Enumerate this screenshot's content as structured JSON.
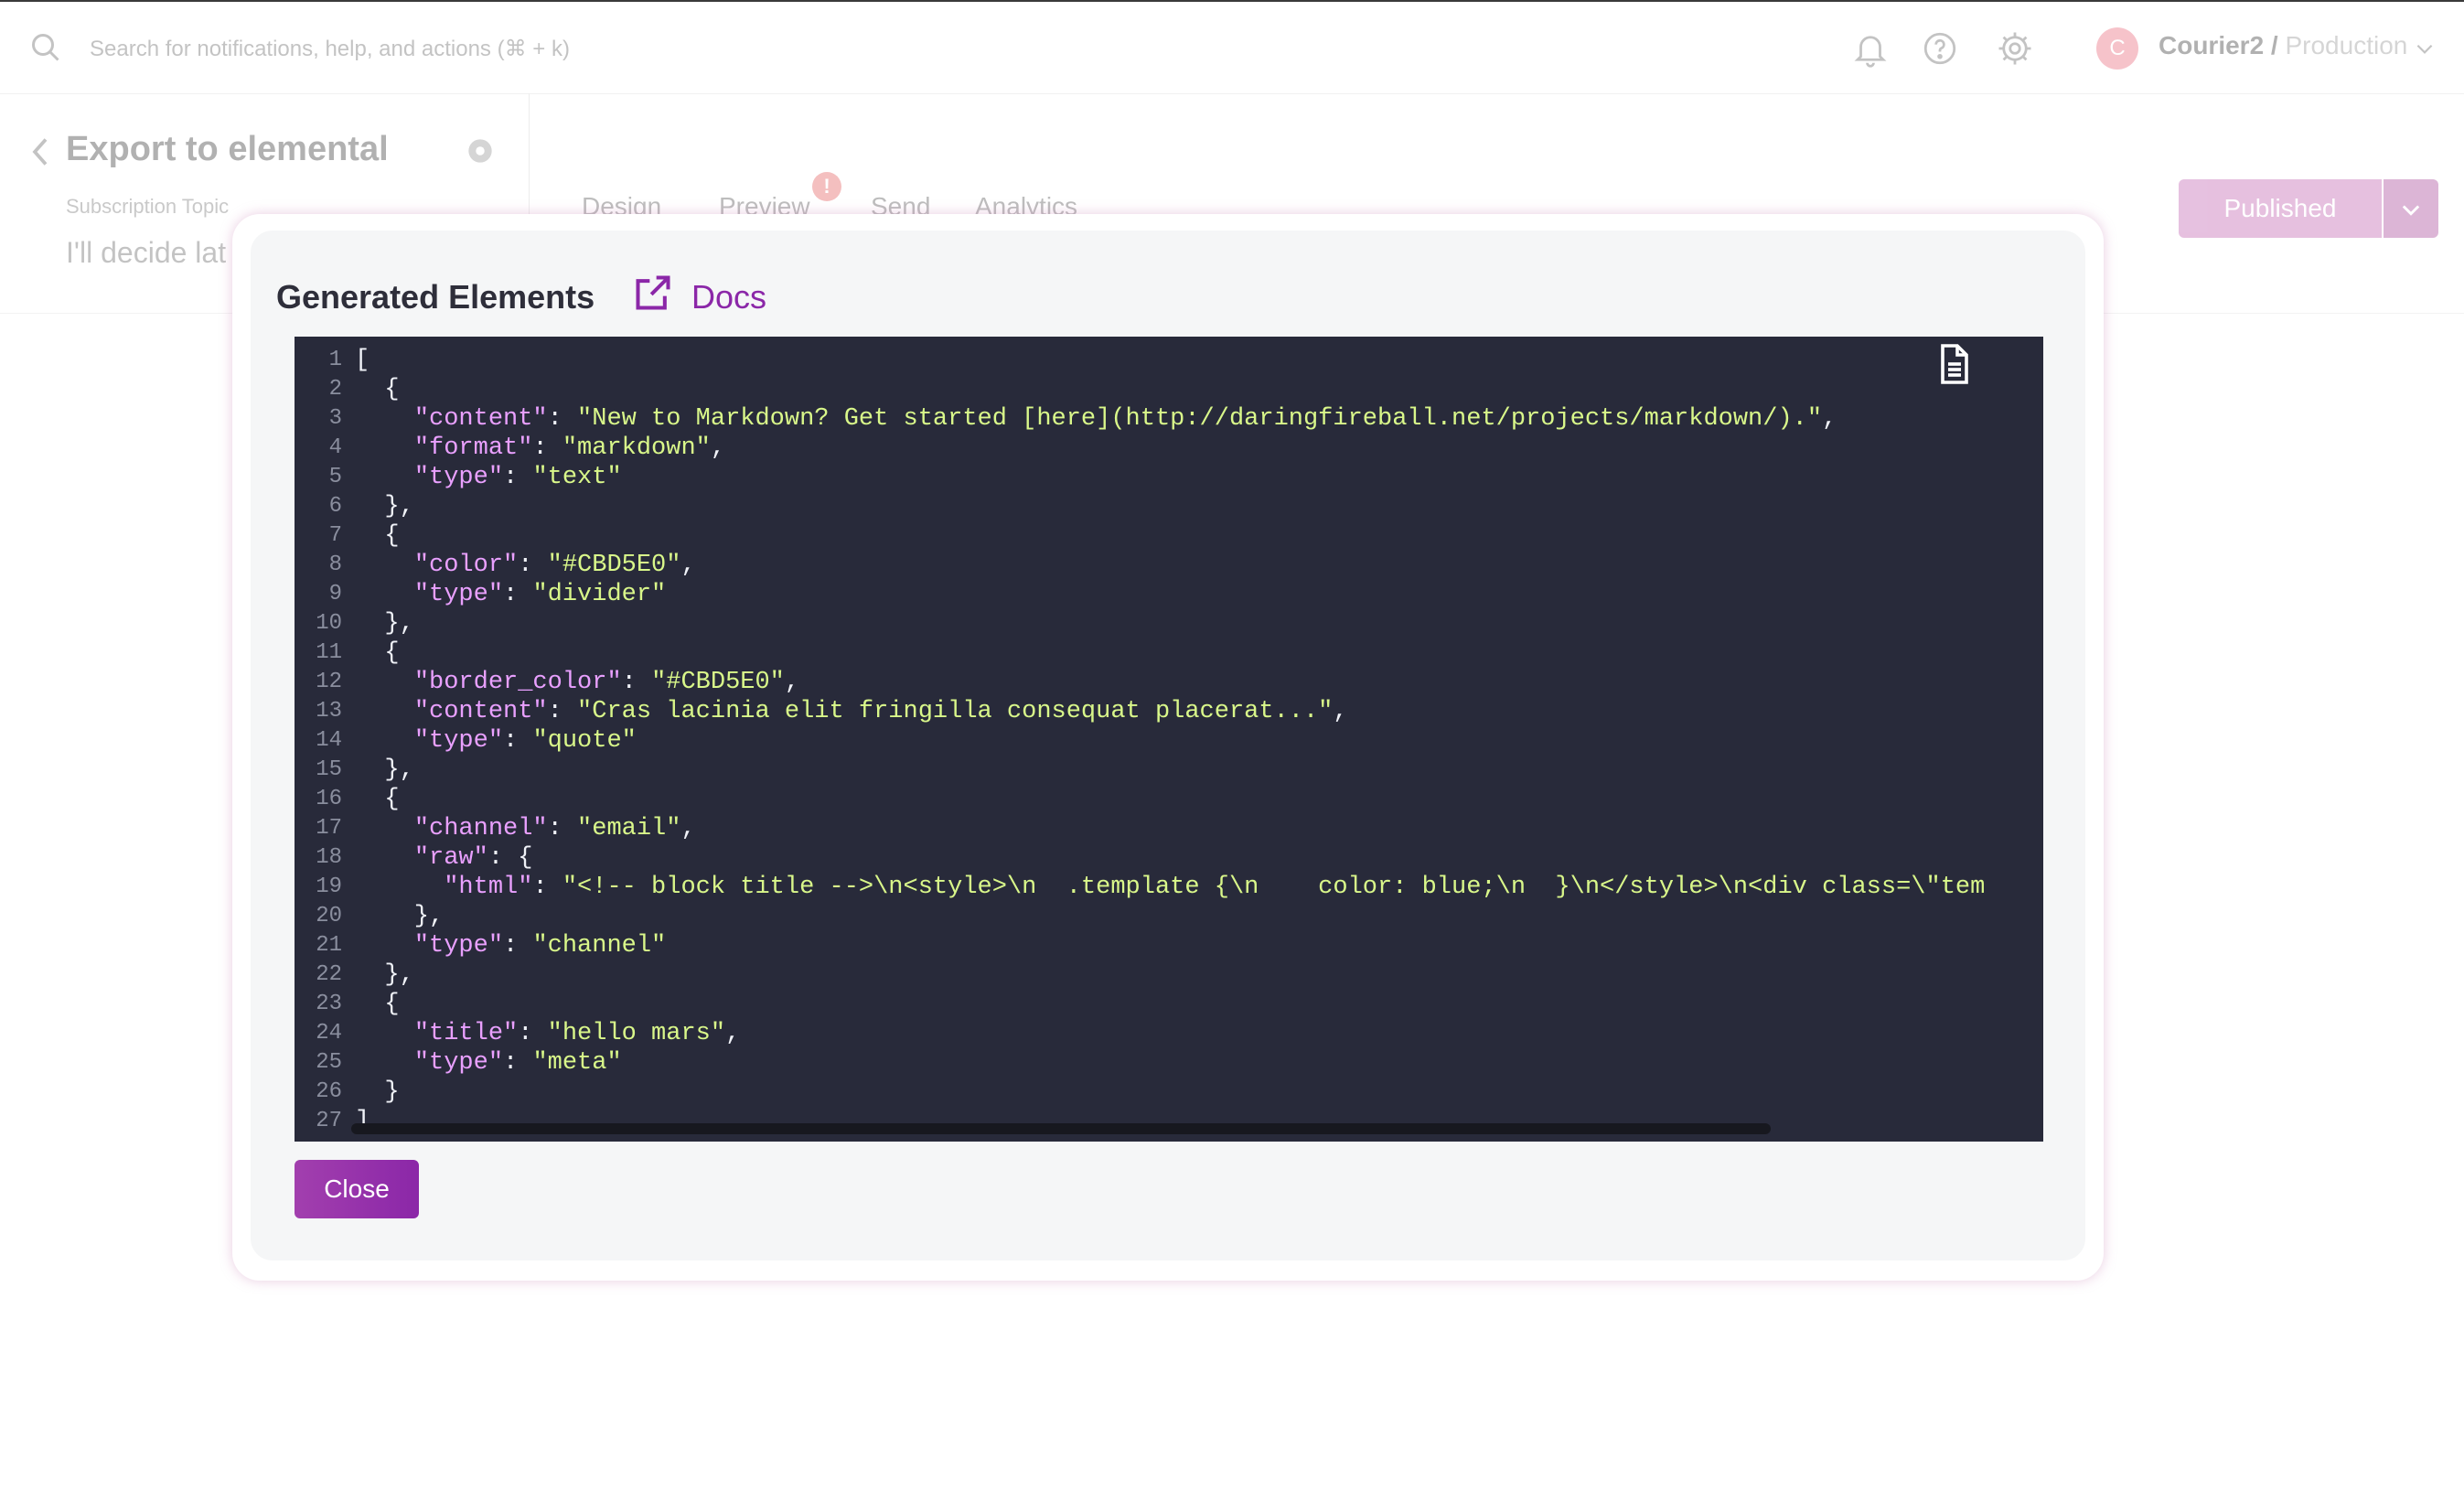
{
  "topbar": {
    "search_placeholder": "Search for notifications, help, and actions (⌘ + k)",
    "avatar_initial": "C",
    "workspace": "Courier2 / ",
    "environment": "Production"
  },
  "template": {
    "title": "Export to elemental",
    "subscription_label": "Subscription Topic",
    "subscription_value": "I'll decide lat",
    "tabs": [
      "Design",
      "Preview",
      "Send",
      "Analytics"
    ],
    "preview_badge": "!",
    "published_label": "Published"
  },
  "modal": {
    "title": "Generated Elements",
    "docs_label": "Docs",
    "close_label": "Close",
    "code_lines": [
      "[",
      "  {",
      "    \"content\": \"New to Markdown? Get started [here](http://daringfireball.net/projects/markdown/).\",",
      "    \"format\": \"markdown\",",
      "    \"type\": \"text\"",
      "  },",
      "  {",
      "    \"color\": \"#CBD5E0\",",
      "    \"type\": \"divider\"",
      "  },",
      "  {",
      "    \"border_color\": \"#CBD5E0\",",
      "    \"content\": \"Cras lacinia elit fringilla consequat placerat...\",",
      "    \"type\": \"quote\"",
      "  },",
      "  {",
      "    \"channel\": \"email\",",
      "    \"raw\": {",
      "      \"html\": \"<!-- block title -->\\n<style>\\n  .template {\\n    color: blue;\\n  }\\n</style>\\n<div class=\\\"tem",
      "    },",
      "    \"type\": \"channel\"",
      "  },",
      "  {",
      "    \"title\": \"hello mars\",",
      "    \"type\": \"meta\"",
      "  }",
      "]"
    ]
  },
  "colors": {
    "accent": "#8b27a8",
    "code_background": "#282a3a",
    "json_key": "#e9a0ff",
    "json_string": "#d9f78a",
    "danger": "#e24a4a"
  },
  "icons": [
    "search-icon",
    "bell-icon",
    "help-icon",
    "gear-icon",
    "chevron-down-icon",
    "chevron-left-icon",
    "external-link-icon",
    "copy-document-icon"
  ]
}
